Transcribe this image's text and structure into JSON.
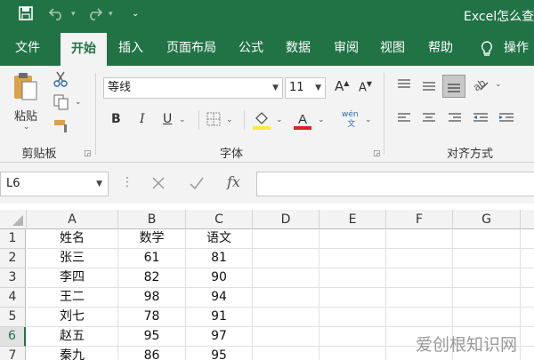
{
  "titlebar": {
    "title": "Excel怎么查"
  },
  "tabs": [
    {
      "label": "文件",
      "active": false
    },
    {
      "label": "开始",
      "active": true
    },
    {
      "label": "插入",
      "active": false
    },
    {
      "label": "页面布局",
      "active": false
    },
    {
      "label": "公式",
      "active": false
    },
    {
      "label": "数据",
      "active": false
    },
    {
      "label": "审阅",
      "active": false
    },
    {
      "label": "视图",
      "active": false
    },
    {
      "label": "帮助",
      "active": false
    },
    {
      "label": "操作",
      "active": false
    }
  ],
  "ribbon": {
    "clipboard": {
      "label": "剪贴板",
      "paste_label": "粘贴"
    },
    "font": {
      "label": "字体",
      "font_name": "等线",
      "font_size": "11",
      "bold": "B",
      "italic": "I",
      "underline": "U",
      "phonetic": "wén\n文"
    },
    "align": {
      "label": "对齐方式"
    }
  },
  "formula_bar": {
    "name_box": "L6",
    "fx": "fx",
    "formula": ""
  },
  "colors": {
    "accent": "#217346",
    "fill_yellow": "#ffeb3b",
    "font_red": "#e02020"
  },
  "grid": {
    "columns": [
      "A",
      "B",
      "C",
      "D",
      "E",
      "F",
      "G"
    ],
    "rows": [
      {
        "num": "1",
        "cells": [
          "姓名",
          "数学",
          "语文"
        ]
      },
      {
        "num": "2",
        "cells": [
          "张三",
          "61",
          "81"
        ]
      },
      {
        "num": "3",
        "cells": [
          "李四",
          "82",
          "90"
        ]
      },
      {
        "num": "4",
        "cells": [
          "王二",
          "98",
          "94"
        ]
      },
      {
        "num": "5",
        "cells": [
          "刘七",
          "78",
          "91"
        ]
      },
      {
        "num": "6",
        "cells": [
          "赵五",
          "95",
          "97"
        ]
      },
      {
        "num": "7",
        "cells": [
          "秦九",
          "86",
          "95"
        ]
      }
    ],
    "selected_row": "6"
  },
  "watermark": "爱创根知识网"
}
